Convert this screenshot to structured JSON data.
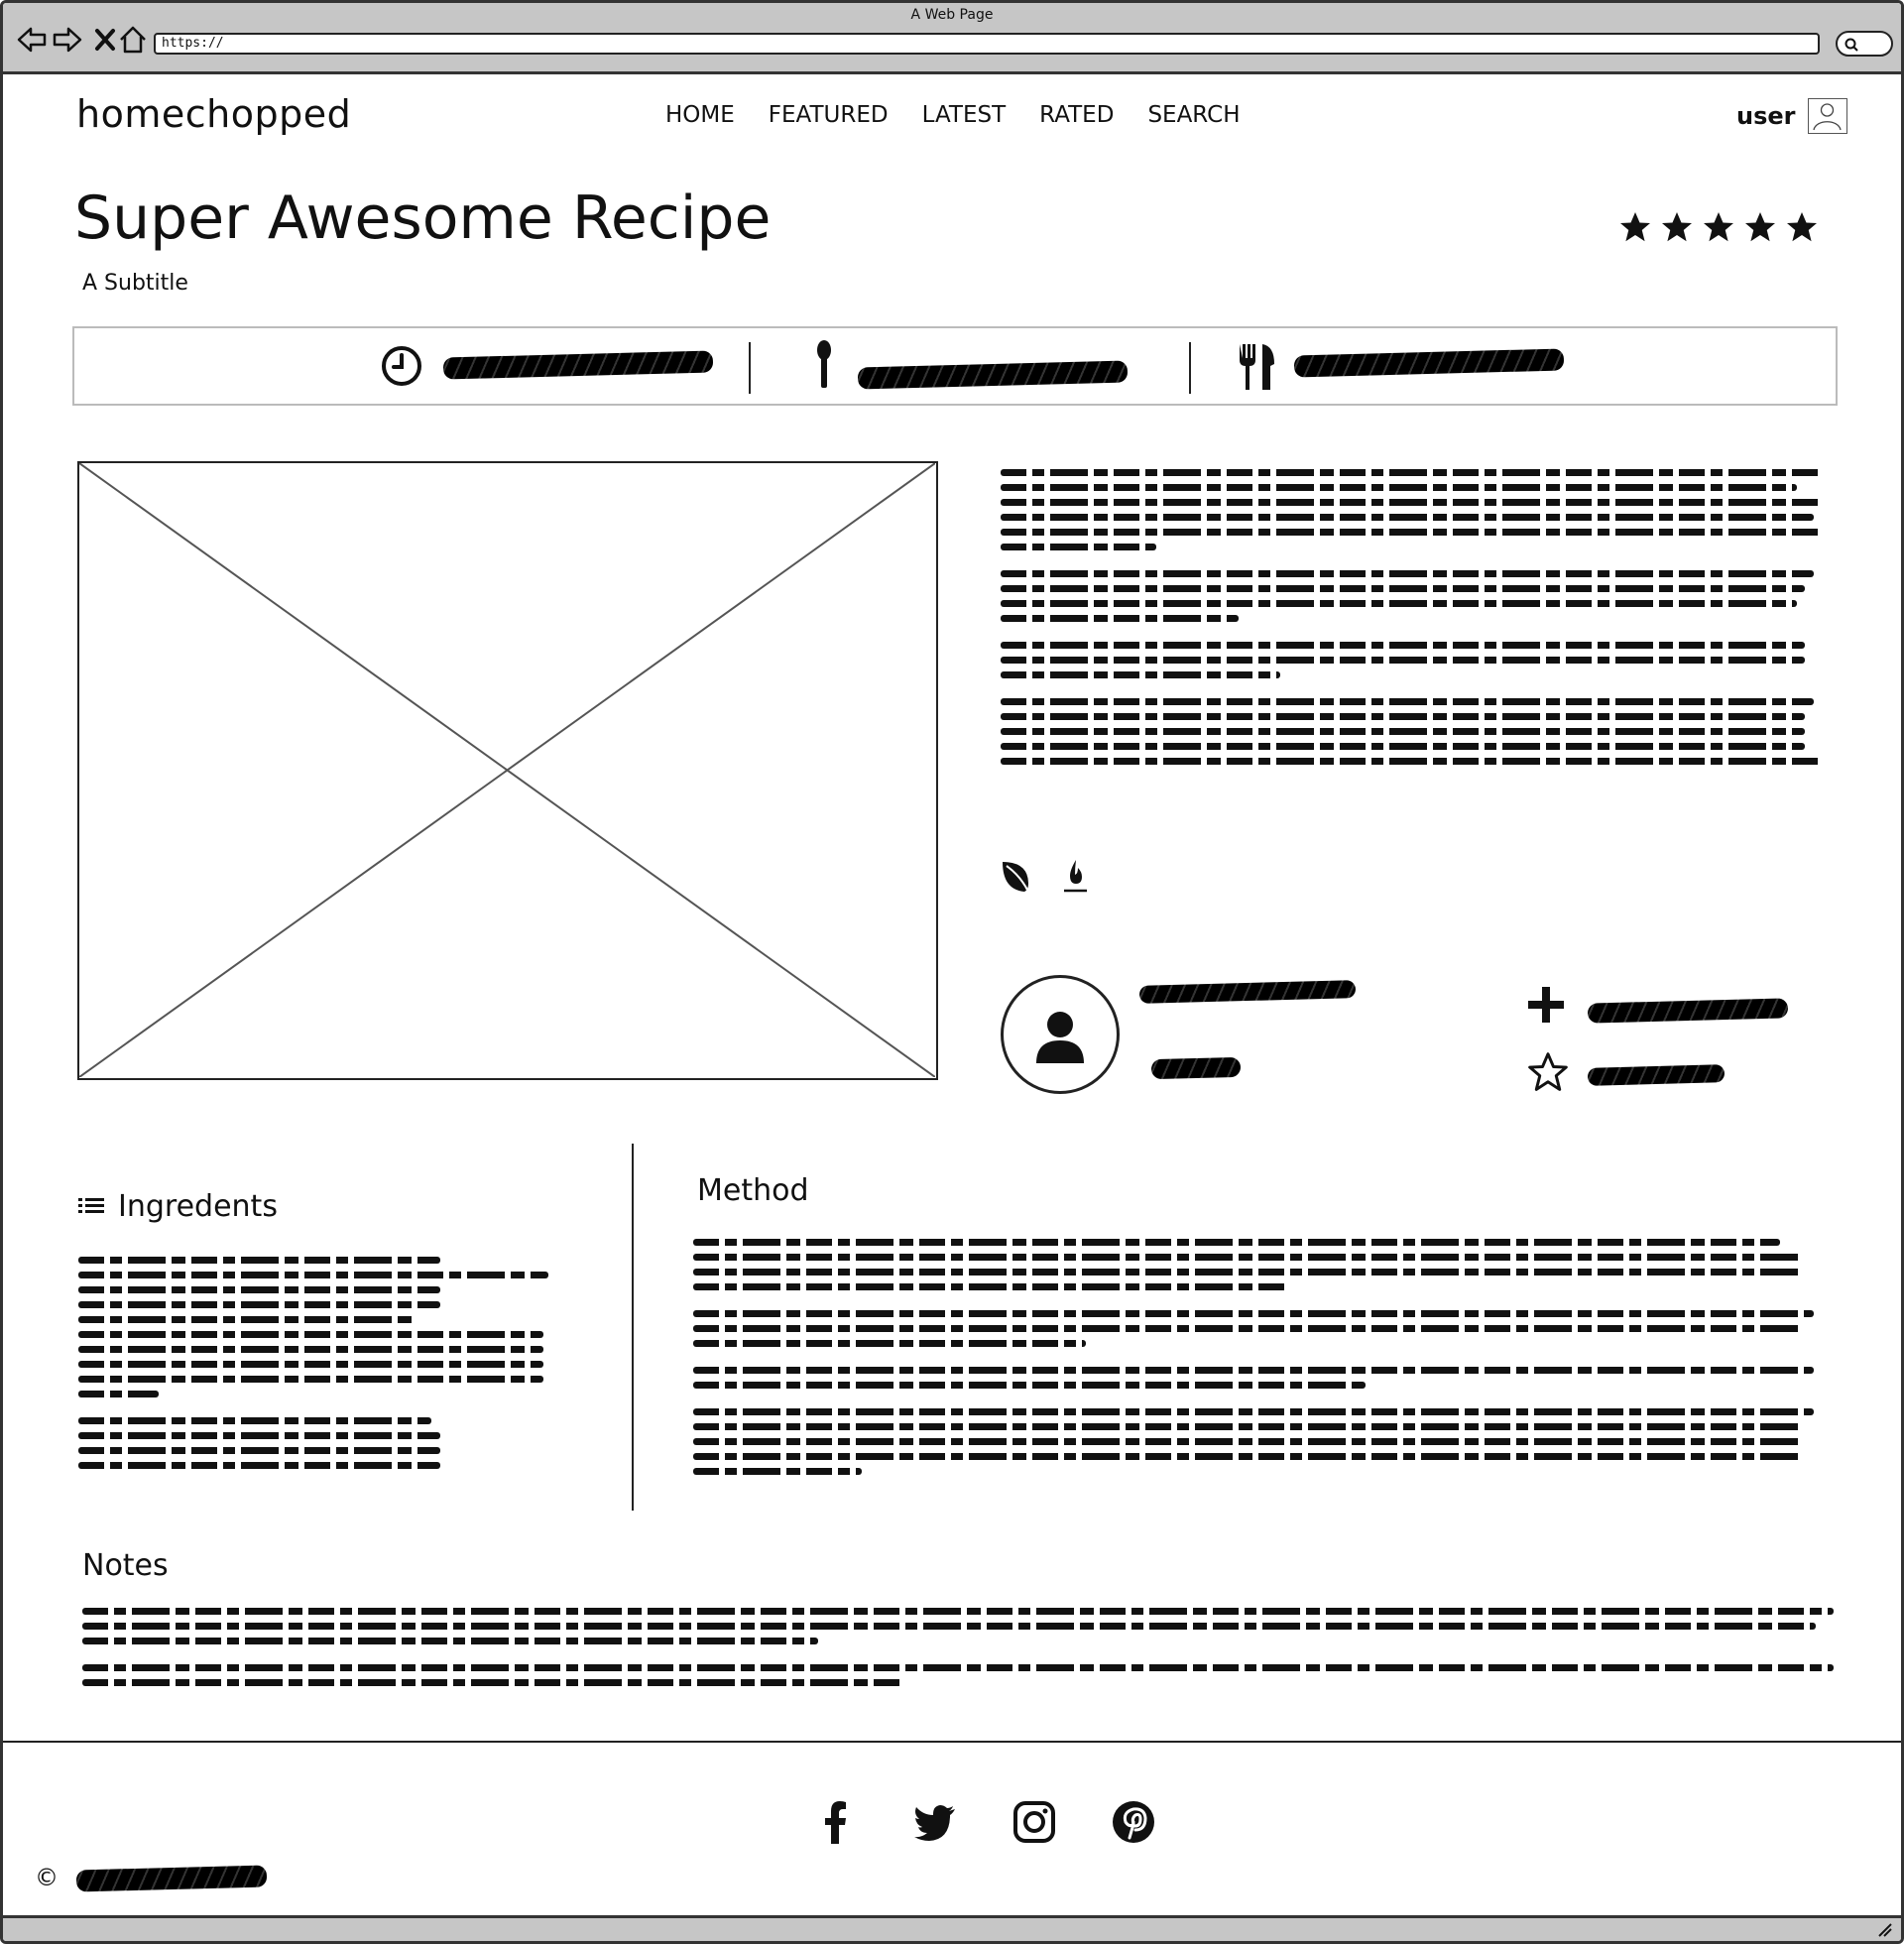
{
  "browser": {
    "window_title": "A Web Page",
    "url": "https://"
  },
  "header": {
    "logo": "homechopped",
    "nav": [
      "HOME",
      "FEATURED",
      "LATEST",
      "RATED",
      "SEARCH"
    ],
    "user_label": "user"
  },
  "recipe": {
    "title": "Super Awesome Recipe",
    "subtitle": "A Subtitle",
    "rating_stars": 5
  },
  "sections": {
    "ingredients_heading": "Ingredents",
    "method_heading": "Method",
    "notes_heading": "Notes"
  },
  "footer": {
    "copyright_symbol": "©"
  },
  "icons": {
    "meta": [
      "clock-icon",
      "spoon-icon",
      "fork-knife-icon"
    ],
    "diet": [
      "leaf-icon",
      "flame-icon"
    ],
    "actions": [
      "plus-icon",
      "star-outline-icon"
    ],
    "social": [
      "facebook-icon",
      "twitter-icon",
      "instagram-icon",
      "pinterest-icon"
    ]
  }
}
